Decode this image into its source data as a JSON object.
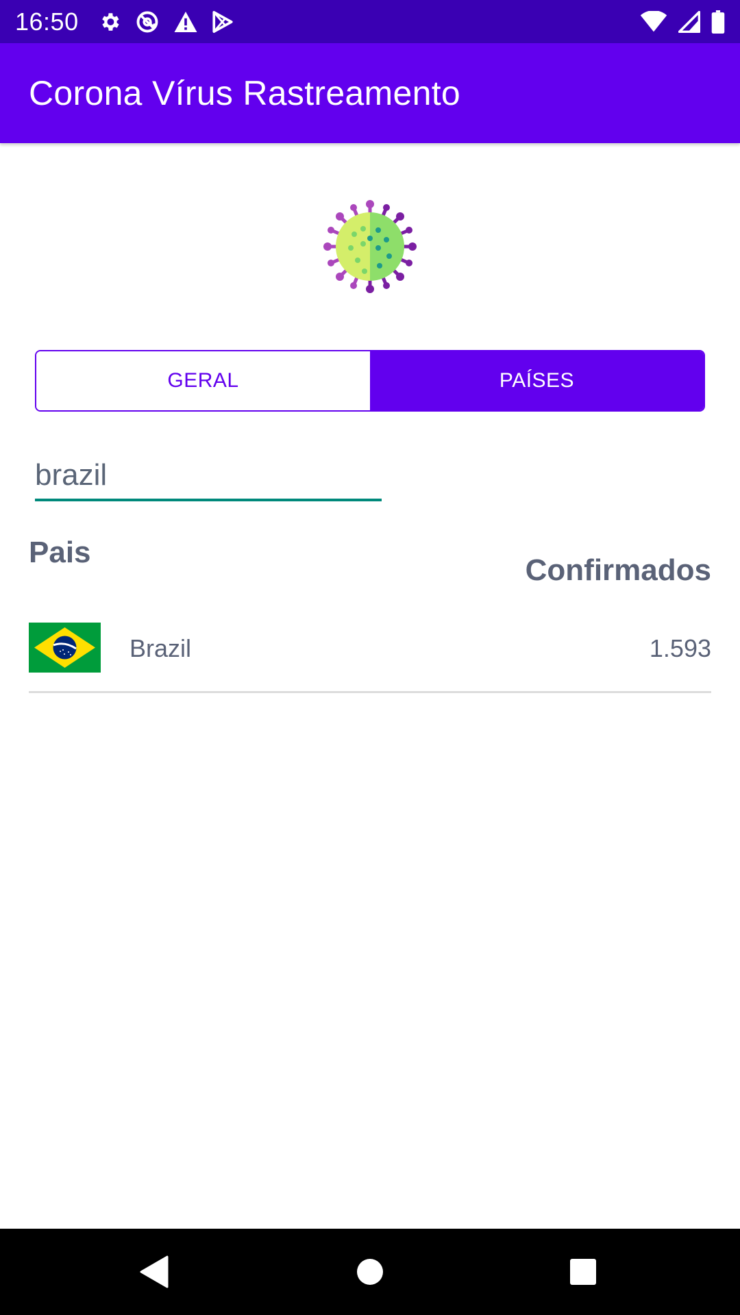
{
  "status_bar": {
    "time": "16:50",
    "left_icons": [
      "gear-icon",
      "at-sign-icon",
      "warning-icon",
      "play-store-icon"
    ],
    "right_icons": [
      "wifi-icon",
      "signal-icon",
      "battery-icon"
    ]
  },
  "app_bar": {
    "title": "Corona Vírus Rastreamento",
    "color": "#6200ee"
  },
  "logo": {
    "icon": "virus-icon"
  },
  "tabs": [
    {
      "label": "GERAL",
      "selected": false
    },
    {
      "label": "PAÍSES",
      "selected": true
    }
  ],
  "search": {
    "value": "brazil"
  },
  "table": {
    "columns": {
      "country": "Pais",
      "confirmed": "Confirmados"
    },
    "rows": [
      {
        "flag": "brazil-flag",
        "country": "Brazil",
        "confirmed": "1.593"
      }
    ]
  },
  "nav_bar": {
    "buttons": [
      "back-icon",
      "home-icon",
      "recents-icon"
    ]
  }
}
